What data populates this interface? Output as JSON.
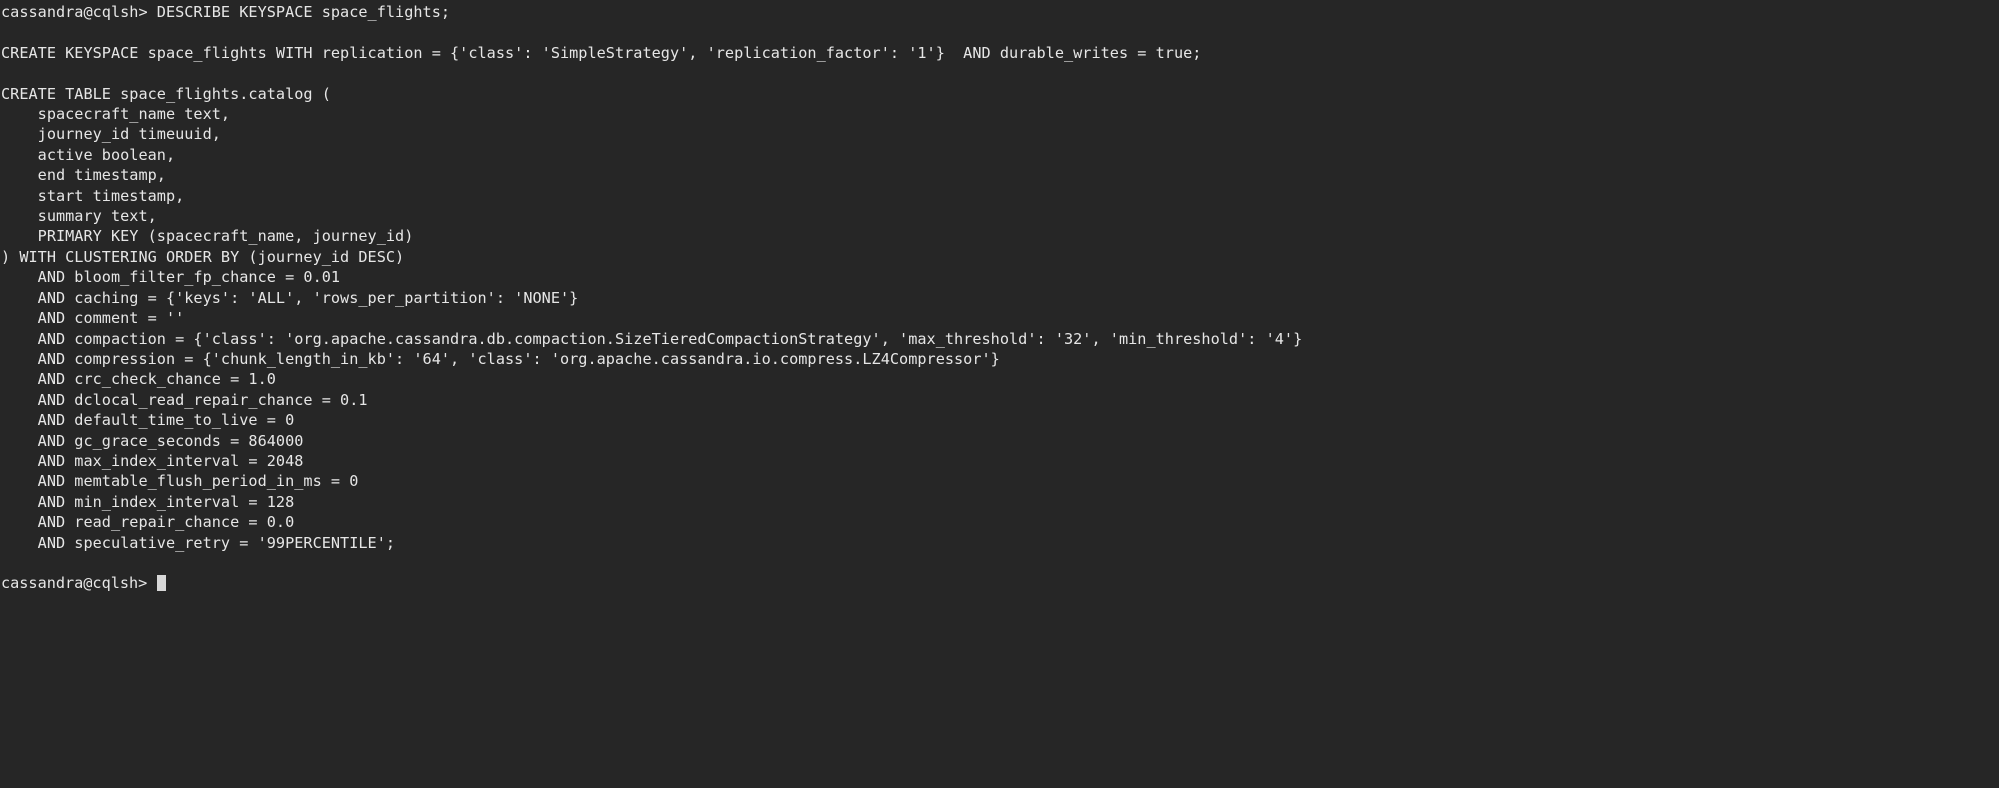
{
  "terminal": {
    "background_color": "#262626",
    "foreground_color": "#e6e6e6",
    "cursor_color": "#d8d8d8",
    "prompt": "cassandra@cqlsh>",
    "command": "DESCRIBE KEYSPACE space_flights;",
    "lines": [
      "cassandra@cqlsh> DESCRIBE KEYSPACE space_flights;",
      "",
      "CREATE KEYSPACE space_flights WITH replication = {'class': 'SimpleStrategy', 'replication_factor': '1'}  AND durable_writes = true;",
      "",
      "CREATE TABLE space_flights.catalog (",
      "    spacecraft_name text,",
      "    journey_id timeuuid,",
      "    active boolean,",
      "    end timestamp,",
      "    start timestamp,",
      "    summary text,",
      "    PRIMARY KEY (spacecraft_name, journey_id)",
      ") WITH CLUSTERING ORDER BY (journey_id DESC)",
      "    AND bloom_filter_fp_chance = 0.01",
      "    AND caching = {'keys': 'ALL', 'rows_per_partition': 'NONE'}",
      "    AND comment = ''",
      "    AND compaction = {'class': 'org.apache.cassandra.db.compaction.SizeTieredCompactionStrategy', 'max_threshold': '32', 'min_threshold': '4'}",
      "    AND compression = {'chunk_length_in_kb': '64', 'class': 'org.apache.cassandra.io.compress.LZ4Compressor'}",
      "    AND crc_check_chance = 1.0",
      "    AND dclocal_read_repair_chance = 0.1",
      "    AND default_time_to_live = 0",
      "    AND gc_grace_seconds = 864000",
      "    AND max_index_interval = 2048",
      "    AND memtable_flush_period_in_ms = 0",
      "    AND min_index_interval = 128",
      "    AND read_repair_chance = 0.0",
      "    AND speculative_retry = '99PERCENTILE';",
      ""
    ],
    "final_prompt": "cassandra@cqlsh> "
  }
}
